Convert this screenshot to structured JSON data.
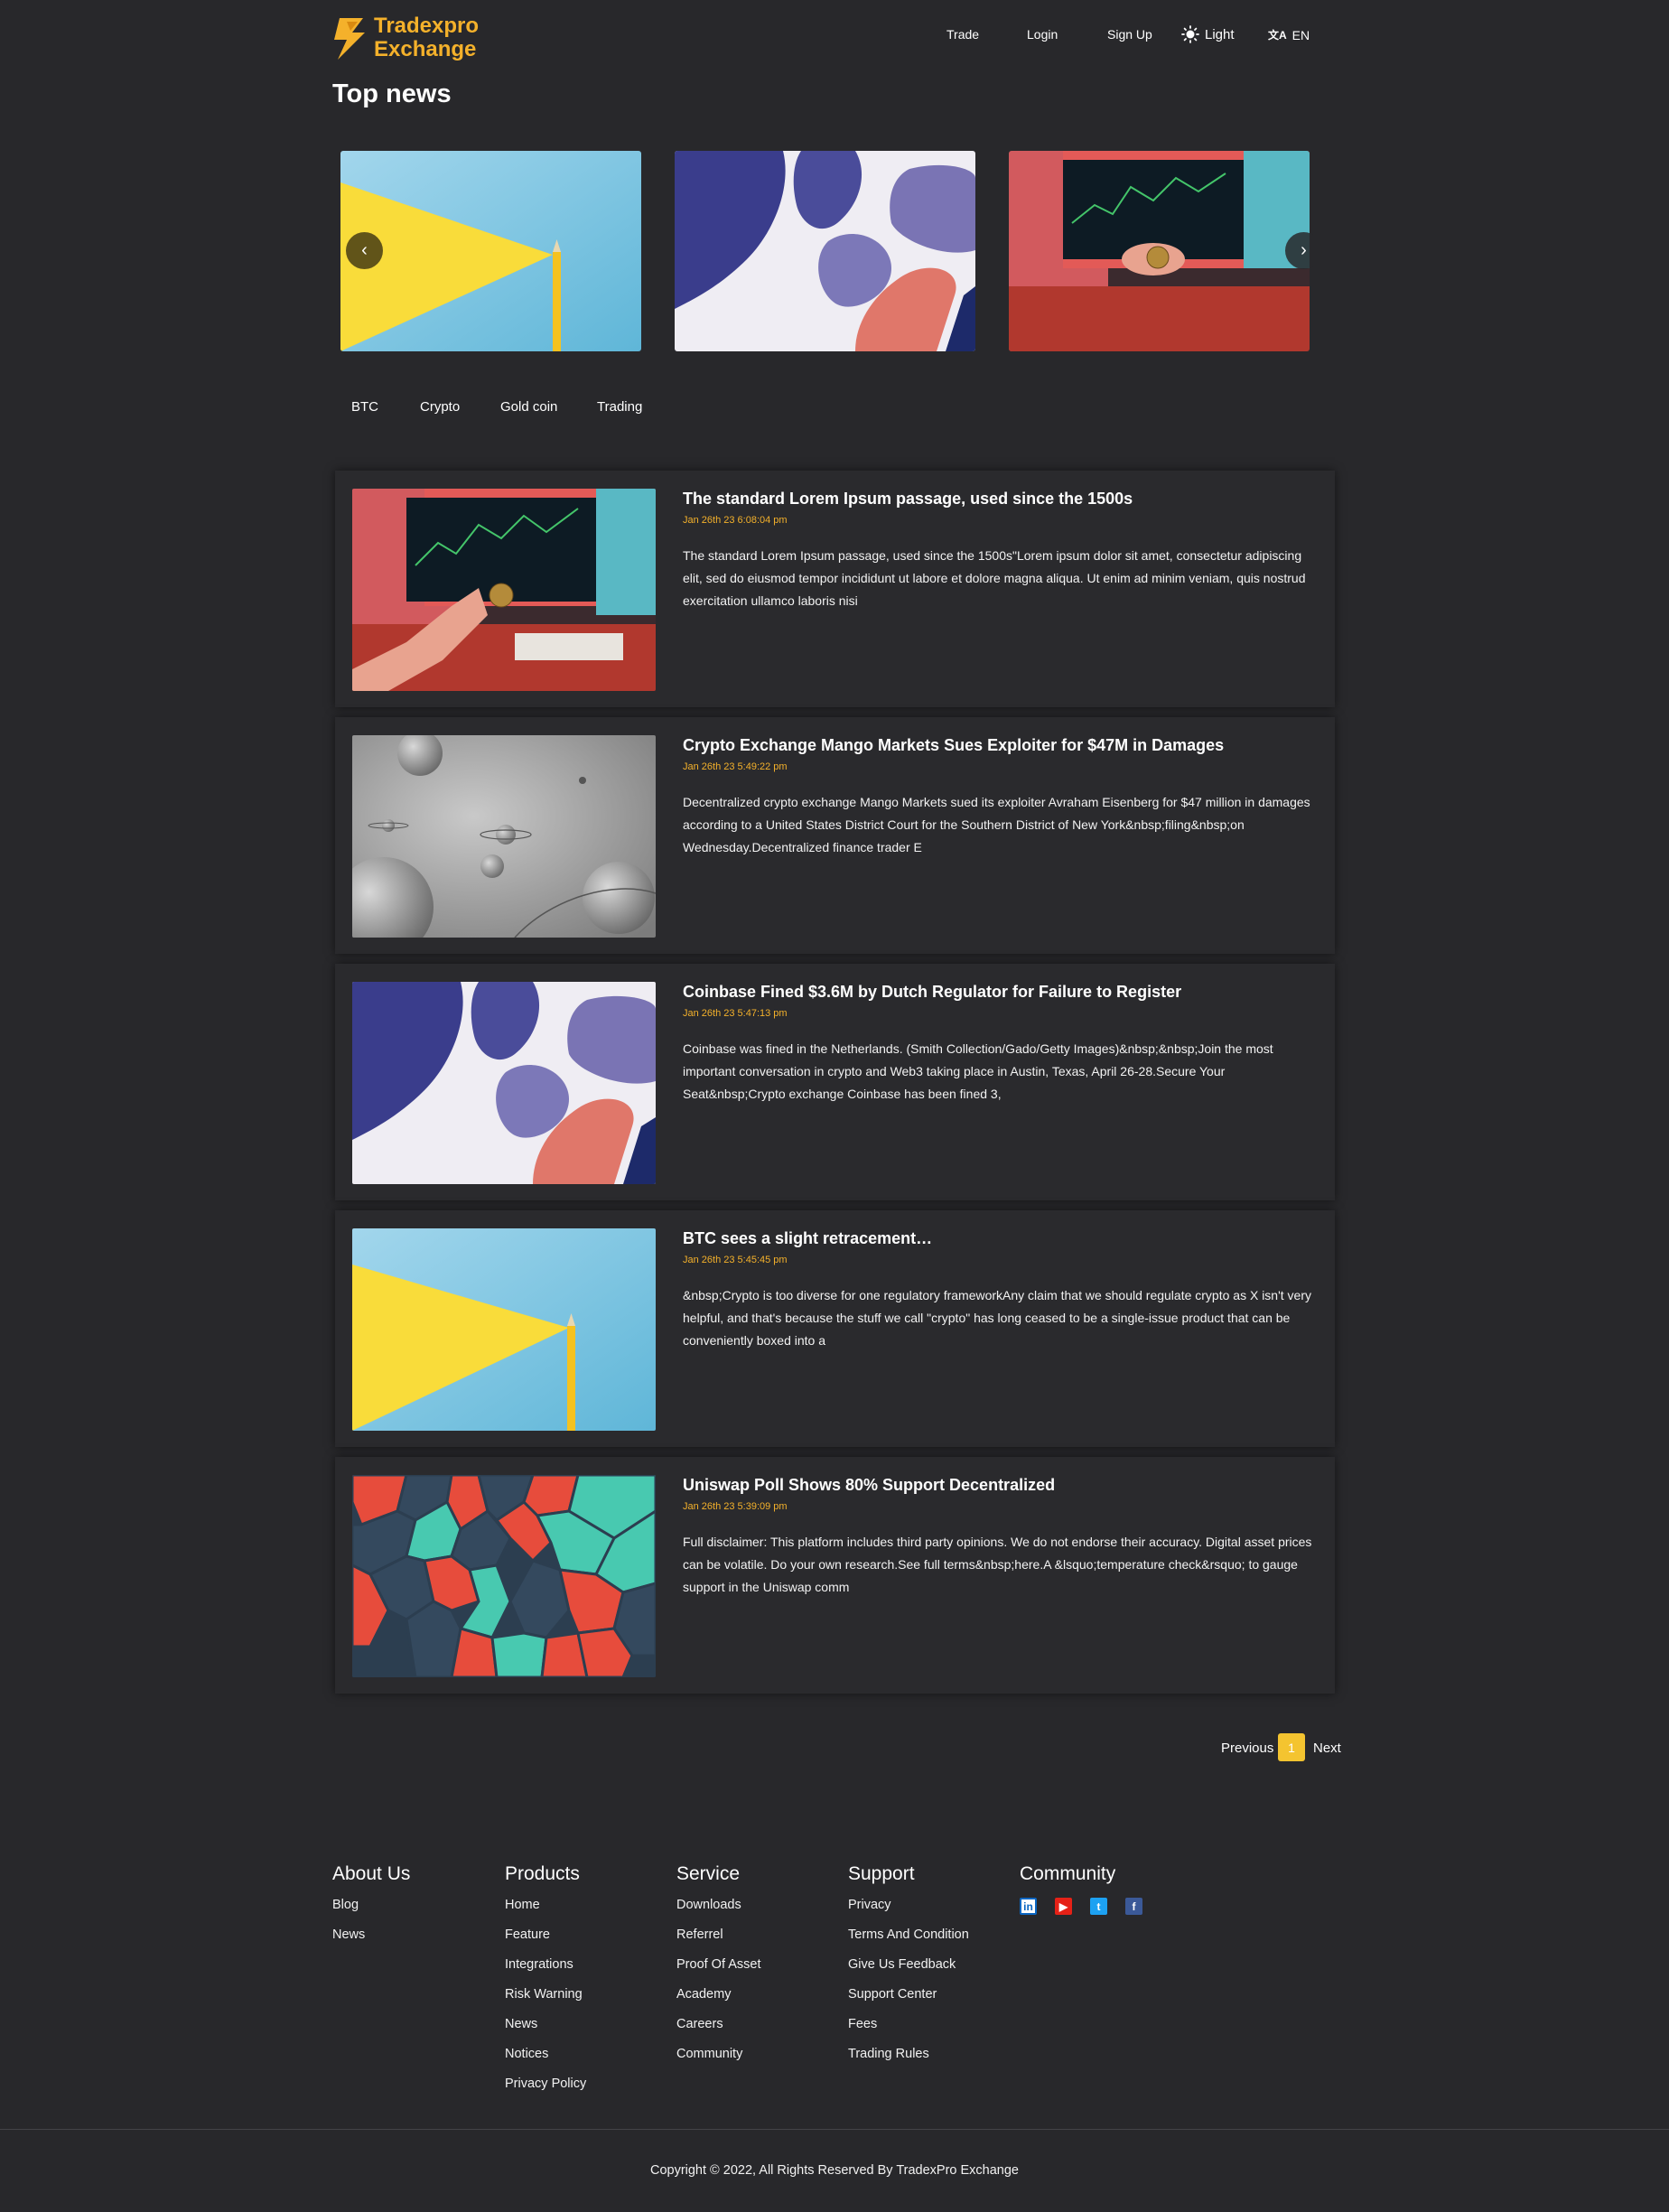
{
  "header": {
    "logo": {
      "line1": "Tradexpro",
      "line2": "Exchange"
    },
    "nav": [
      {
        "label": "Trade"
      },
      {
        "label": "Login"
      },
      {
        "label": "Sign Up"
      }
    ],
    "theme": {
      "label": "Light",
      "icon": "sun-icon"
    },
    "language": {
      "label": "EN",
      "icon": "translate-icon"
    }
  },
  "page_title": "Top news",
  "carousel": {
    "slides": [
      {
        "image": "yellow-pencil-on-blue"
      },
      {
        "image": "abstract-purple-shapes"
      },
      {
        "image": "hand-holding-bitcoin-trading-screen"
      }
    ],
    "prev_icon": "chevron-left-icon",
    "next_icon": "chevron-right-icon"
  },
  "tags": [
    "BTC",
    "Crypto",
    "Gold coin",
    "Trading"
  ],
  "articles": [
    {
      "title": "The standard Lorem Ipsum passage, used since the 1500s",
      "date": "Jan 26th 23 6:08:04 pm",
      "body": "The standard Lorem Ipsum passage, used since the 1500s\"Lorem ipsum dolor sit amet, consectetur adipiscing elit, sed do eiusmod tempor incididunt ut labore et dolore magna aliqua. Ut enim ad minim veniam, quis nostrud exercitation ullamco laboris nisi",
      "image": "hand-holding-bitcoin-trading-screen"
    },
    {
      "title": "Crypto Exchange Mango Markets Sues Exploiter for $47M in Damages",
      "date": "Jan 26th 23 5:49:22 pm",
      "body": "Decentralized crypto exchange Mango Markets sued its exploiter Avraham Eisenberg for $47 million in damages according to a United States District Court for the Southern District of New York&nbsp;filing&nbsp;on Wednesday.Decentralized finance trader E",
      "image": "grey-planets"
    },
    {
      "title": "Coinbase Fined $3.6M by Dutch Regulator for Failure to Register",
      "date": "Jan 26th 23 5:47:13 pm",
      "body": "Coinbase was fined in the Netherlands. (Smith Collection/Gado/Getty Images)&nbsp;&nbsp;Join the most important conversation in crypto and Web3 taking place in Austin, Texas, April 26-28.Secure Your Seat&nbsp;Crypto exchange Coinbase has been fined 3,",
      "image": "abstract-purple-shapes"
    },
    {
      "title": "BTC sees a slight retracement…",
      "date": "Jan 26th 23 5:45:45 pm",
      "body": "&nbsp;Crypto is too diverse for one regulatory frameworkAny claim that we should regulate crypto as X isn't very helpful, and that's because the stuff we call \"crypto\" has long ceased to be a single-issue product that can be conveniently boxed into a",
      "image": "yellow-pencil-on-blue"
    },
    {
      "title": "Uniswap Poll Shows 80% Support Decentralized",
      "date": "Jan 26th 23 5:39:09 pm",
      "body": "Full disclaimer: This platform includes third party opinions. We do not endorse their accuracy. Digital asset prices can be volatile. Do your own research.See full terms&nbsp;here.A &lsquo;temperature check&rsquo; to gauge support in the Uniswap comm",
      "image": "voronoi-mosaic"
    }
  ],
  "pagination": {
    "previous": "Previous",
    "current": "1",
    "next": "Next"
  },
  "footer": {
    "columns": [
      {
        "title": "About Us",
        "links": [
          "Blog",
          "News"
        ]
      },
      {
        "title": "Products",
        "links": [
          "Home",
          "Feature",
          "Integrations",
          "Risk Warning",
          "News",
          "Notices",
          "Privacy Policy"
        ]
      },
      {
        "title": "Service",
        "links": [
          "Downloads",
          "Referrel",
          "Proof Of Asset",
          "Academy",
          "Careers",
          "Community"
        ]
      },
      {
        "title": "Support",
        "links": [
          "Privacy",
          "Terms And Condition",
          "Give Us Feedback",
          "Support Center",
          "Fees",
          "Trading Rules"
        ]
      }
    ],
    "community": {
      "title": "Community",
      "icons": [
        "linkedin-icon",
        "youtube-icon",
        "twitter-icon",
        "facebook-icon"
      ]
    },
    "copyright": "Copyright © 2022, All Rights Reserved By TradexPro Exchange"
  },
  "colors": {
    "background": "#28282b",
    "accent": "#f4b12b",
    "active_page": "#f4c430"
  }
}
